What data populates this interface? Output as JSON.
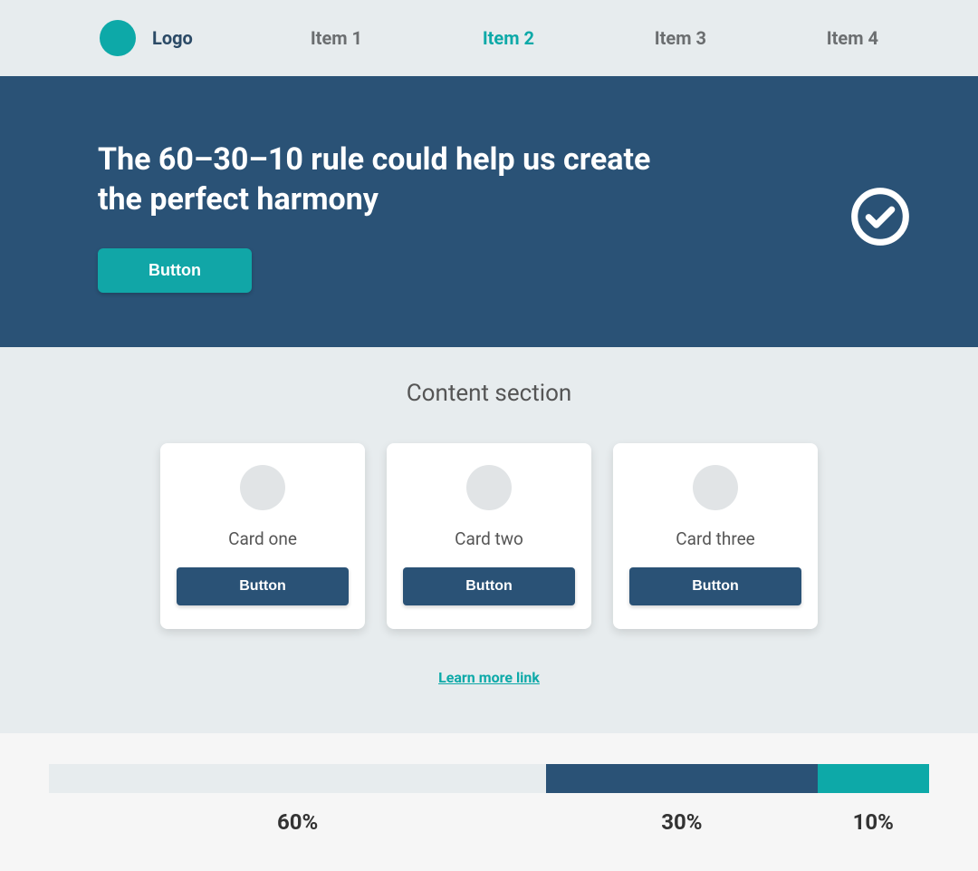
{
  "nav": {
    "logo_label": "Logo",
    "items": [
      {
        "label": "Item 1",
        "active": false
      },
      {
        "label": "Item 2",
        "active": true
      },
      {
        "label": "Item 3",
        "active": false
      },
      {
        "label": "Item 4",
        "active": false
      }
    ]
  },
  "hero": {
    "title": "The 60–30–10 rule could help us create the perfect harmony",
    "button_label": "Button",
    "check_icon": "check-circle"
  },
  "content": {
    "section_title": "Content section",
    "cards": [
      {
        "title": "Card one",
        "button_label": "Button"
      },
      {
        "title": "Card two",
        "button_label": "Button"
      },
      {
        "title": "Card three",
        "button_label": "Button"
      }
    ],
    "learn_more_label": "Learn more link"
  },
  "ratio": {
    "segments": [
      {
        "label": "60%",
        "color": "#e7ecee",
        "pct": 60
      },
      {
        "label": "30%",
        "color": "#2a5276",
        "pct": 30
      },
      {
        "label": "10%",
        "color": "#0da9a8",
        "pct": 10
      }
    ]
  },
  "colors": {
    "primary_neutral": "#e7ecee",
    "primary_dark": "#2a5276",
    "accent": "#0da9a8",
    "white": "#ffffff"
  }
}
